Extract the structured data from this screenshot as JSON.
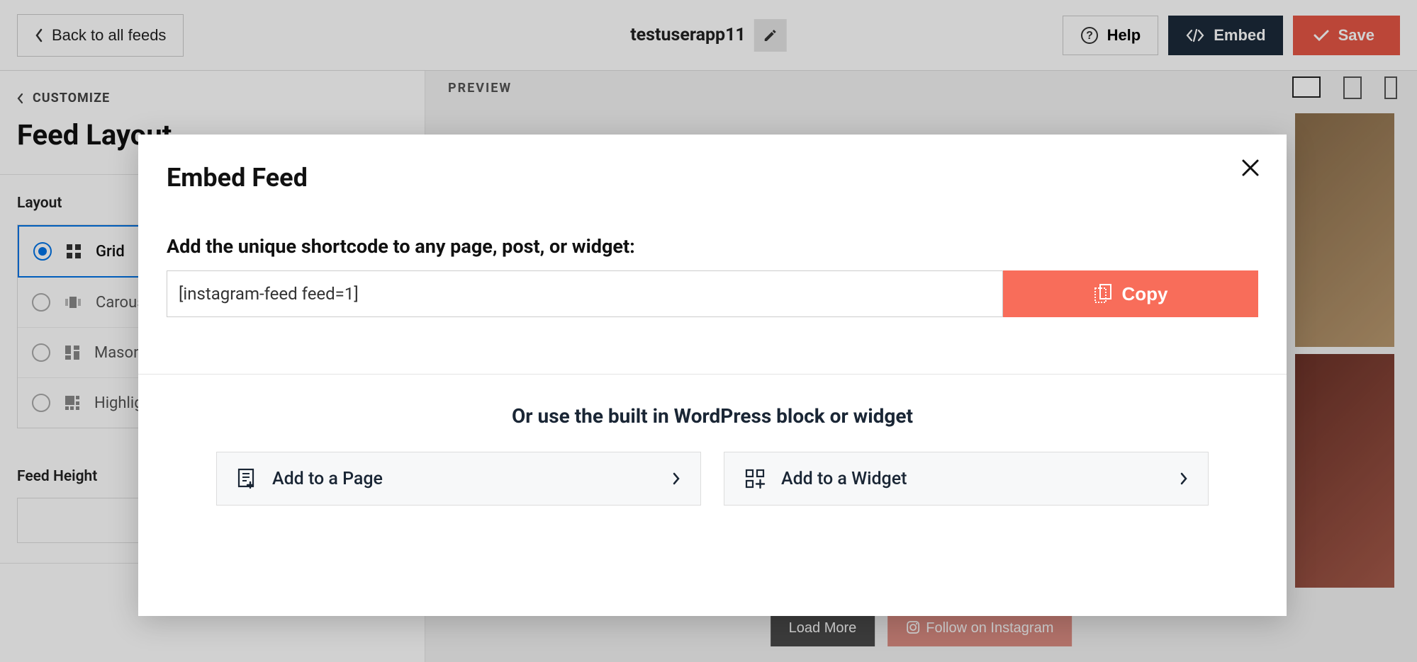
{
  "header": {
    "back_label": "Back to all feeds",
    "feed_name": "testuserapp11",
    "help_label": "Help",
    "embed_label": "Embed",
    "save_label": "Save"
  },
  "sidebar": {
    "customize_back": "CUSTOMIZE",
    "section_title": "Feed Layout",
    "layout_heading": "Layout",
    "options": [
      {
        "label": "Grid",
        "selected": true
      },
      {
        "label": "Carousel",
        "selected": false
      },
      {
        "label": "Masonry",
        "selected": false
      },
      {
        "label": "Highlight",
        "selected": false
      }
    ],
    "feed_height_label": "Feed Height",
    "feed_height_value": ""
  },
  "preview": {
    "label": "PREVIEW",
    "load_more": "Load More",
    "follow_btn": "Follow on Instagram"
  },
  "modal": {
    "title": "Embed Feed",
    "shortcode_prompt": "Add the unique shortcode to any page, post, or widget:",
    "shortcode_value": "[instagram-feed feed=1]",
    "copy_label": "Copy",
    "alt_heading": "Or use the built in WordPress block or widget",
    "add_page_label": "Add to a Page",
    "add_widget_label": "Add to a Widget"
  }
}
